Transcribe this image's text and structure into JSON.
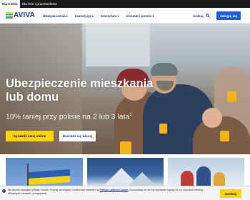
{
  "topbar": {
    "tabs": [
      {
        "label": "Dla Ciebie",
        "active": true
      },
      {
        "label": "Dla firm i pracowników",
        "active": false
      }
    ]
  },
  "navbar": {
    "logo_text": "AVIVA",
    "items": [
      {
        "label": "Ubezpieczenia"
      },
      {
        "label": "Inwestycje"
      },
      {
        "label": "Emerytura"
      },
      {
        "label": "Kontakt i pomoc"
      }
    ],
    "search_label": "Szukaj",
    "login_label": "Zaloguj się"
  },
  "hero": {
    "title": "Ubezpieczenie mieszkania lub domu",
    "subtitle": "10% taniej przy polisie na 2 lub 3 lata",
    "subtitle_sup": "1",
    "cta_primary": "Sprawdź cenę online",
    "cta_secondary": "Dowiedz się więcej"
  },
  "cookie": {
    "icon": "i",
    "text_before": "Na stronie używamy plików Cookie. Poznaj szczegóły i możliwości ustawień w ",
    "link_text": "Polityce plików Cookie",
    "text_after": ". Korzystając ze strony wyrażasz zgodę na ich używanie według aktualnych ustawień przeglądarki.",
    "accept_label": "Zamknij"
  },
  "colors": {
    "brand_blue": "#1f3d99",
    "accent_yellow": "#ffd200",
    "login_blue": "#1f5fd6"
  },
  "icons": {
    "search": "search-icon",
    "logo": "aviva-logo-icon"
  }
}
